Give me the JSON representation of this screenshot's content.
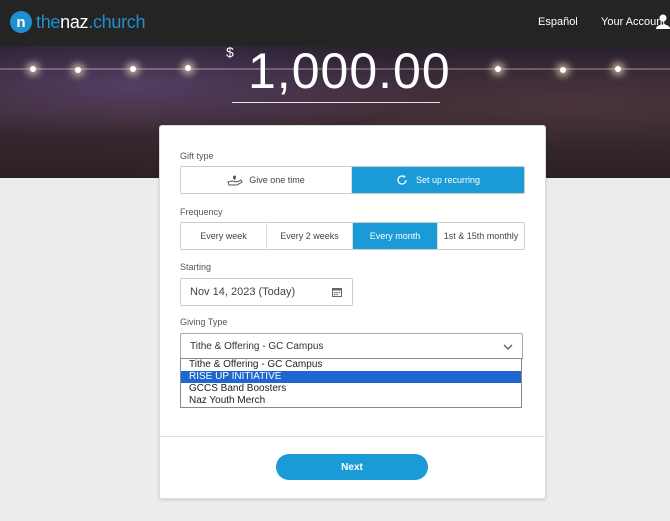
{
  "header": {
    "logo_letter": "n",
    "logo_prefix": "the",
    "logo_mid": "naz",
    "logo_suffix": ".church",
    "language_link": "Español",
    "account_link": "Your Account",
    "account_icon": "user-icon"
  },
  "gift": {
    "currency_symbol": "$",
    "amount": "1,000.00"
  },
  "form": {
    "gift_type_label": "Gift type",
    "gift_type_options": [
      {
        "label": "Give one time",
        "icon": "hand-heart-icon",
        "selected": false
      },
      {
        "label": "Set up recurring",
        "icon": "refresh-icon",
        "selected": true
      }
    ],
    "frequency_label": "Frequency",
    "frequency_options": [
      {
        "label": "Every week",
        "selected": false
      },
      {
        "label": "Every 2 weeks",
        "selected": false
      },
      {
        "label": "Every month",
        "selected": true
      },
      {
        "label": "1st & 15th monthly",
        "selected": false
      }
    ],
    "starting_label": "Starting",
    "starting_value": "Nov 14, 2023 (Today)",
    "giving_type_label": "Giving Type",
    "giving_type_value": "Tithe & Offering - GC Campus",
    "giving_type_options": [
      {
        "label": "Tithe & Offering - GC Campus",
        "highlighted": false
      },
      {
        "label": "RISE UP INITIATIVE",
        "highlighted": true
      },
      {
        "label": "GCCS Band Boosters",
        "highlighted": false
      },
      {
        "label": "Naz Youth Merch",
        "highlighted": false
      }
    ],
    "next_label": "Next"
  },
  "colors": {
    "accent": "#1a9ad6",
    "highlight": "#1e66d0",
    "topbar": "#242424"
  }
}
